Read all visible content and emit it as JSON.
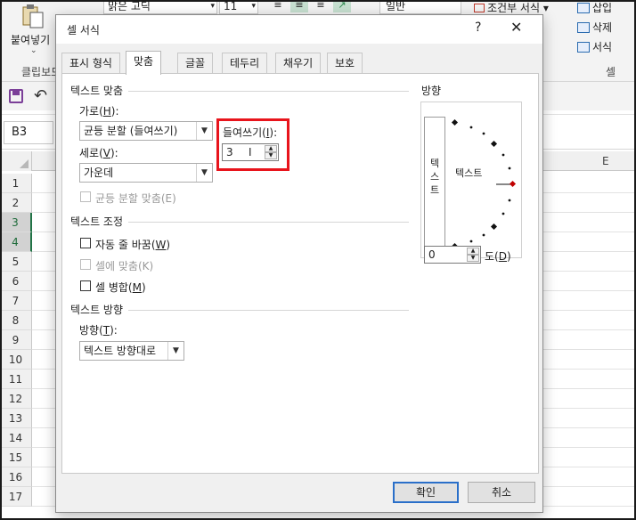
{
  "excel": {
    "ribbon": {
      "paste_label": "붙여넣기",
      "clipboard_label": "클립보드",
      "font_name": "맑은 고딕",
      "font_size": "11",
      "number_format": "일반",
      "conditional_format": "조건부 서식",
      "insert_label": "삽입",
      "delete_label": "삭제",
      "format_label": "서식",
      "cells_label": "셀"
    },
    "name_box": "B3",
    "column_e": "E",
    "rows": [
      "1",
      "2",
      "3",
      "4",
      "5",
      "6",
      "7",
      "8",
      "9",
      "10",
      "11",
      "12",
      "13",
      "14",
      "15",
      "16",
      "17"
    ],
    "selected_rows": [
      "3",
      "4"
    ]
  },
  "dialog": {
    "title": "셀 서식",
    "help": "?",
    "close": "✕",
    "tabs": [
      "표시 형식",
      "맞춤",
      "글꼴",
      "테두리",
      "채우기",
      "보호"
    ],
    "active_tab": "맞춤",
    "text_alignment": {
      "section_title": "텍스트 맞춤",
      "horizontal_label": "가로(",
      "horizontal_key": "H",
      "horizontal_value": "균등 분할 (들여쓰기)",
      "vertical_label": "세로(",
      "vertical_key": "V",
      "vertical_value": "가운데",
      "justify_distributed_label": "균등 분할 맞춤(E)",
      "indent_label": "들여쓰기(",
      "indent_key": "I",
      "indent_value": "3"
    },
    "text_control": {
      "section_title": "텍스트 조정",
      "wrap_text_label": "자동 줄 바꿈(",
      "wrap_text_key": "W",
      "wrap_text_checked": false,
      "shrink_to_fit_label": "셀에 맞춤(K)",
      "merge_cells_label": "셀 병합(",
      "merge_cells_key": "M",
      "merge_cells_checked": false
    },
    "text_direction": {
      "section_title": "텍스트 방향",
      "direction_label": "방향(",
      "direction_key": "T",
      "direction_value": "텍스트 방향대로"
    },
    "orientation": {
      "section_title": "방향",
      "vertical_text": [
        "텍",
        "스",
        "트"
      ],
      "dial_text": "텍스트",
      "degrees_value": "0",
      "degrees_label": "도(",
      "degrees_key": "D",
      "accent_color": "#c00000"
    },
    "buttons": {
      "ok": "확인",
      "cancel": "취소"
    },
    "highlight_color": "#e8141c"
  }
}
